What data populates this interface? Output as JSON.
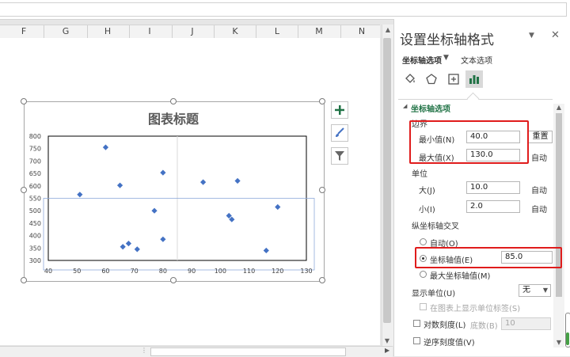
{
  "columns": [
    "F",
    "G",
    "H",
    "I",
    "J",
    "K",
    "L",
    "M",
    "N"
  ],
  "chart": {
    "title": "图表标题"
  },
  "chart_data": {
    "type": "scatter",
    "title": "图表标题",
    "xlim": [
      40,
      130
    ],
    "ylim": [
      300,
      800
    ],
    "x_ticks": [
      "40",
      "50",
      "60",
      "70",
      "80",
      "90",
      "100",
      "110",
      "120",
      "130"
    ],
    "y_ticks": [
      "800",
      "750",
      "700",
      "650",
      "600",
      "550",
      "500",
      "450",
      "400",
      "350",
      "300"
    ],
    "vertical_axis_crosses_at": 85,
    "marker_color": "#4472c4",
    "points": [
      {
        "x": 51,
        "y": 565
      },
      {
        "x": 60,
        "y": 755
      },
      {
        "x": 65,
        "y": 602
      },
      {
        "x": 66,
        "y": 355
      },
      {
        "x": 68,
        "y": 368
      },
      {
        "x": 71,
        "y": 345
      },
      {
        "x": 77,
        "y": 500
      },
      {
        "x": 80,
        "y": 653
      },
      {
        "x": 80,
        "y": 385
      },
      {
        "x": 94,
        "y": 615
      },
      {
        "x": 103,
        "y": 480
      },
      {
        "x": 104,
        "y": 465
      },
      {
        "x": 106,
        "y": 620
      },
      {
        "x": 116,
        "y": 340
      },
      {
        "x": 120,
        "y": 515
      }
    ]
  },
  "pane": {
    "title": "设置坐标轴格式",
    "tabs": {
      "axis_options": "坐标轴选项",
      "text_options": "文本选项"
    },
    "section_title": "坐标轴选项",
    "bounds": {
      "label": "边界",
      "min_label": "最小值(N)",
      "min_value": "40.0",
      "min_action": "重置",
      "max_label": "最大值(X)",
      "max_value": "130.0",
      "max_action": "自动"
    },
    "units": {
      "label": "单位",
      "major_label": "大(J)",
      "major_value": "10.0",
      "major_action": "自动",
      "minor_label": "小(I)",
      "minor_value": "2.0",
      "minor_action": "自动"
    },
    "cross": {
      "label": "纵坐标轴交叉",
      "auto_label": "自动(O)",
      "axis_value_label": "坐标轴值(E)",
      "axis_value": "85.0",
      "max_value_label": "最大坐标轴值(M)"
    },
    "display_units": {
      "label": "显示单位(U)",
      "value": "无",
      "show_label": "在图表上显示单位标签(S)"
    },
    "log_scale": {
      "label": "对数刻度(L)",
      "base_label": "底数(B)",
      "base_value": "10"
    },
    "reverse": {
      "label": "逆序刻度值(V)"
    }
  },
  "colors": {
    "accent_green": "#217346",
    "highlight_red": "#e01c1c",
    "marker_blue": "#4472c4"
  }
}
